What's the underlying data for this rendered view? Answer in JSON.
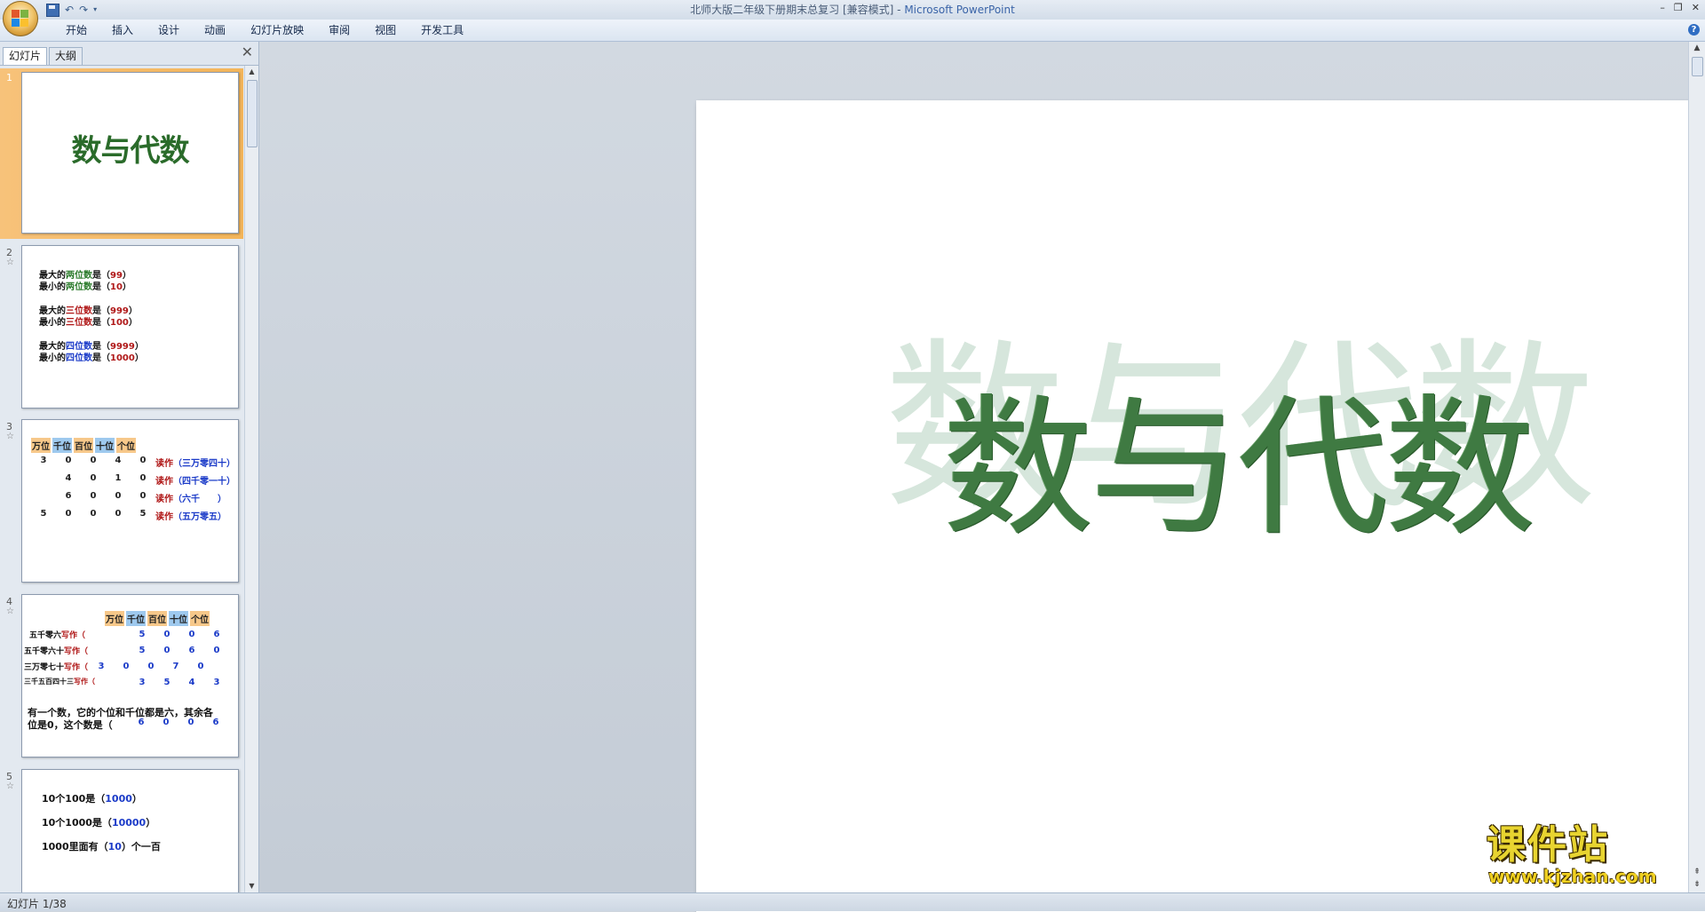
{
  "titlebar": {
    "doc_title": "北师大版二年级下册期末总复习 [兼容模式] -",
    "app_name": "Microsoft PowerPoint",
    "quick_access": [
      "save-icon",
      "undo-icon",
      "redo-icon",
      "customize-icon"
    ]
  },
  "ribbon": {
    "tabs": [
      "开始",
      "插入",
      "设计",
      "动画",
      "幻灯片放映",
      "审阅",
      "视图",
      "开发工具"
    ]
  },
  "panel": {
    "tab_slides": "幻灯片",
    "tab_outline": "大纲"
  },
  "slides": [
    {
      "num": "1",
      "title": "数与代数"
    },
    {
      "num": "2",
      "lines": [
        {
          "a": "最大的",
          "b": "两位数",
          "c": "是（",
          "v": "99",
          "d": "）"
        },
        {
          "a": "最小的",
          "b": "两位数",
          "c": "是（",
          "v": "10",
          "d": "）"
        },
        {
          "a": "最大的",
          "b": "三位数",
          "c": "是（",
          "v": "999",
          "d": "）"
        },
        {
          "a": "最小的",
          "b": "三位数",
          "c": "是（",
          "v": "100",
          "d": "）"
        },
        {
          "a": "最大的",
          "b": "四位数",
          "c": "是（",
          "v": "9999",
          "d": "）"
        },
        {
          "a": "最小的",
          "b": "四位数",
          "c": "是（",
          "v": "1000",
          "d": "）"
        }
      ]
    },
    {
      "num": "3",
      "headers": [
        "万位",
        "千位",
        "百位",
        "十位",
        "个位"
      ],
      "rows": [
        {
          "digits": [
            "3",
            "0",
            "0",
            "4",
            "0"
          ],
          "label": "读作",
          "text": "（三万零四十）"
        },
        {
          "digits": [
            "",
            "4",
            "0",
            "1",
            "0"
          ],
          "label": "读作",
          "text": "（四千零一十）"
        },
        {
          "digits": [
            "",
            "6",
            "0",
            "0",
            "0"
          ],
          "label": "读作",
          "text": "（六千　　）"
        },
        {
          "digits": [
            "5",
            "0",
            "0",
            "0",
            "5"
          ],
          "label": "读作",
          "text": "（五万零五）"
        }
      ]
    },
    {
      "num": "4",
      "headers": [
        "万位",
        "千位",
        "百位",
        "十位",
        "个位"
      ],
      "rows": [
        {
          "words": "五千零六",
          "label": "写作（",
          "digits": [
            "",
            "5",
            "0",
            "0",
            "6"
          ]
        },
        {
          "words": "五千零六十",
          "label": "写作（",
          "digits": [
            "",
            "5",
            "0",
            "6",
            "0"
          ]
        },
        {
          "words": "三万零七十",
          "label": "写作（",
          "digits": [
            "3",
            "0",
            "0",
            "7",
            "0"
          ]
        },
        {
          "words": "三千五百四十三",
          "label": "写作（",
          "digits": [
            "",
            "3",
            "5",
            "4",
            "3"
          ]
        }
      ],
      "question_line1": "有一个数，它的个位和千位都是六，其余各",
      "question_line2": "位是0，这个数是（",
      "answer_digits": [
        "6",
        "0",
        "0",
        "6"
      ]
    },
    {
      "num": "5",
      "lines": [
        {
          "q": "10个100是（",
          "v": "1000",
          "e": "）"
        },
        {
          "q": "10个1000是（",
          "v": "10000",
          "e": "）"
        },
        {
          "q": "1000里面有（",
          "v": "10",
          "e": "）个一百"
        }
      ]
    }
  ],
  "editor": {
    "slide_title": "数与代数",
    "slide_title_shadow": "数与代数"
  },
  "watermark": {
    "brand_cn": "课件站",
    "url": "www.kjzhan.com"
  },
  "status": {
    "slide_indicator": "幻灯片 1/38"
  },
  "colors": {
    "title_green": "#3f7a42",
    "shadow_green": "#d6e6dc",
    "selected_orange": "#f3b55a"
  }
}
